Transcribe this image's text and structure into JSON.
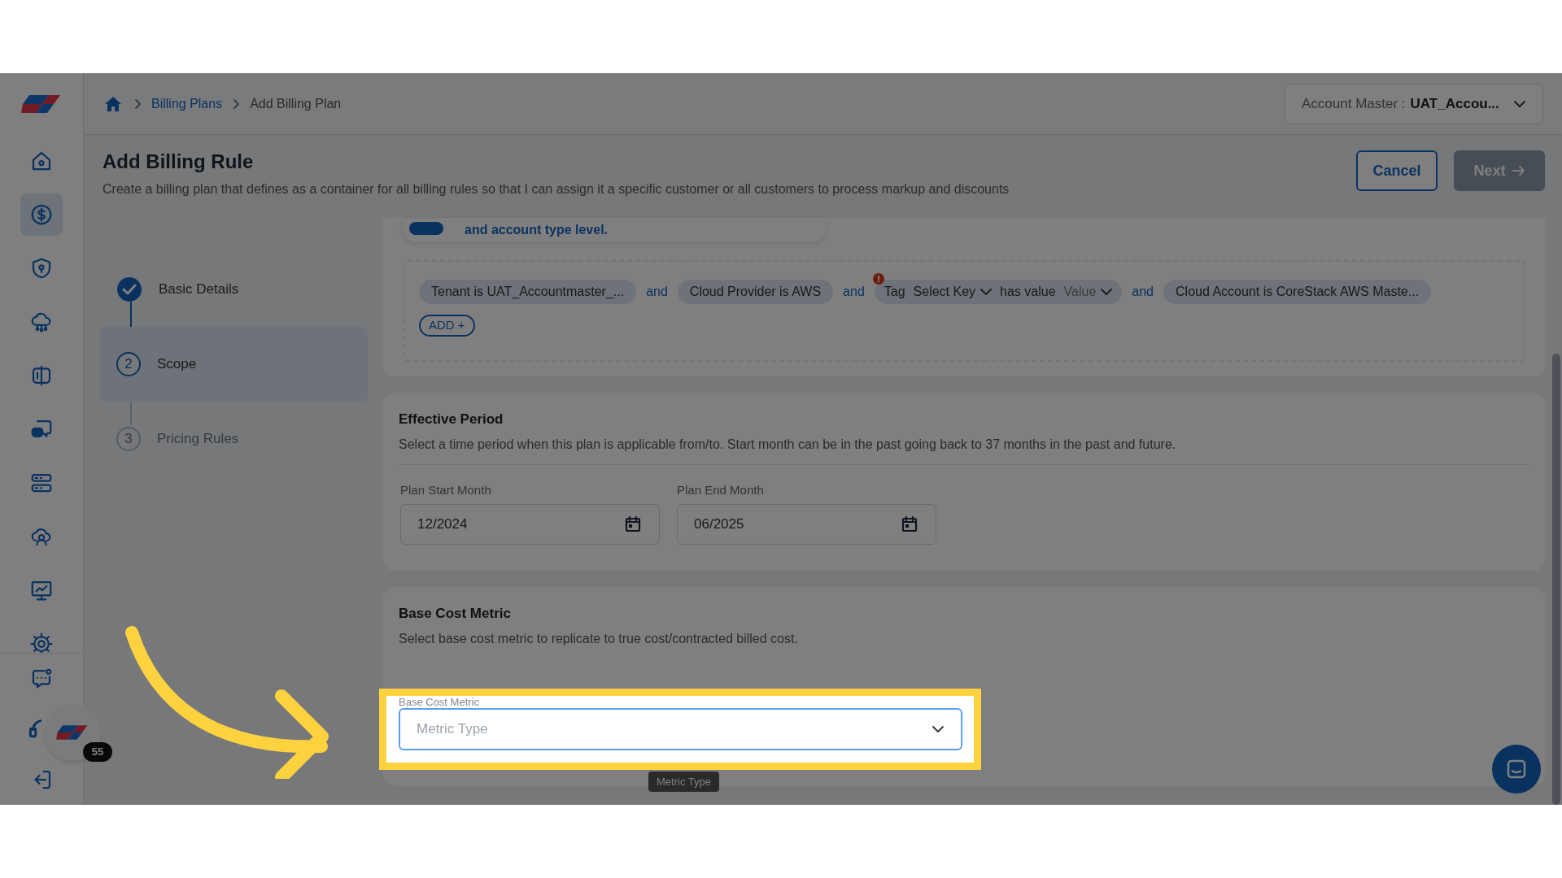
{
  "sidebar": {
    "items": [
      {
        "selected": false
      },
      {
        "selected": true
      },
      {
        "selected": false
      },
      {
        "selected": false
      },
      {
        "selected": false
      },
      {
        "selected": false
      },
      {
        "selected": false
      },
      {
        "selected": false
      },
      {
        "selected": false
      },
      {
        "selected": false
      }
    ],
    "bottom_items": [
      {
        "selected": false
      },
      {
        "selected": false
      },
      {
        "selected": false
      }
    ]
  },
  "breadcrumb": {
    "items": [
      "Billing Plans",
      "Add Billing Plan"
    ]
  },
  "account_selector": {
    "label": "Account Master :",
    "value": "UAT_Accou..."
  },
  "page": {
    "title": "Add Billing Rule",
    "description": "Create a billing plan that defines as a container for all billing rules so that I can assign it a specific customer or all customers to process markup and discounts"
  },
  "actions": [
    {
      "label": "Cancel",
      "disabled": false
    },
    {
      "label": "Next",
      "disabled": true
    }
  ],
  "steps": [
    {
      "label": "Basic Details",
      "completed": true,
      "selected": false
    },
    {
      "label": "Scope",
      "number": "2",
      "completed": false,
      "selected": true
    },
    {
      "label": "Pricing Rules",
      "number": "3",
      "completed": false,
      "selected": false
    }
  ],
  "scope": {
    "info": "and account type level.",
    "conditions": [
      {
        "kind": "chip",
        "text": "Tenant is UAT_Accountmaster_..."
      },
      {
        "kind": "joiner",
        "text": "and"
      },
      {
        "kind": "chip",
        "text": "Cloud Provider is AWS"
      },
      {
        "kind": "joiner",
        "text": "and"
      },
      {
        "kind": "tag",
        "label": "Tag",
        "key": "Select Key",
        "operator": "has value",
        "value": "Value",
        "error": true
      },
      {
        "kind": "joiner",
        "text": "and"
      },
      {
        "kind": "chip",
        "text": "Cloud Account is CoreStack AWS Maste..."
      }
    ],
    "add_button": "ADD +"
  },
  "effective_period": {
    "title": "Effective Period",
    "description": "Select a time period when this plan is applicable from/to. Start month can be in the past going back to 37 months in the past and future.",
    "fields": [
      {
        "label": "Plan Start Month",
        "value": "12/2024"
      },
      {
        "label": "Plan End Month",
        "value": "06/2025"
      }
    ]
  },
  "base_cost_metric": {
    "title": "Base Cost Metric",
    "description": "Select base cost metric to replicate to true cost/contracted billed cost.",
    "field": {
      "label": "Base Cost Metric",
      "placeholder": "Metric Type"
    },
    "tooltip": "Metric Type"
  },
  "notification_badge": "55"
}
